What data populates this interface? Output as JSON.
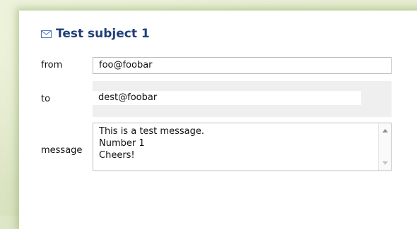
{
  "window": {
    "title": "Test subject 1",
    "title_icon": "envelope-icon",
    "accent_color": "#1f3f78"
  },
  "form": {
    "from": {
      "label": "from",
      "value": "foo@foobar"
    },
    "to": {
      "label": "to",
      "value": "dest@foobar"
    },
    "message": {
      "label": "message",
      "value": "This is a test message.\nNumber 1\nCheers!"
    }
  }
}
